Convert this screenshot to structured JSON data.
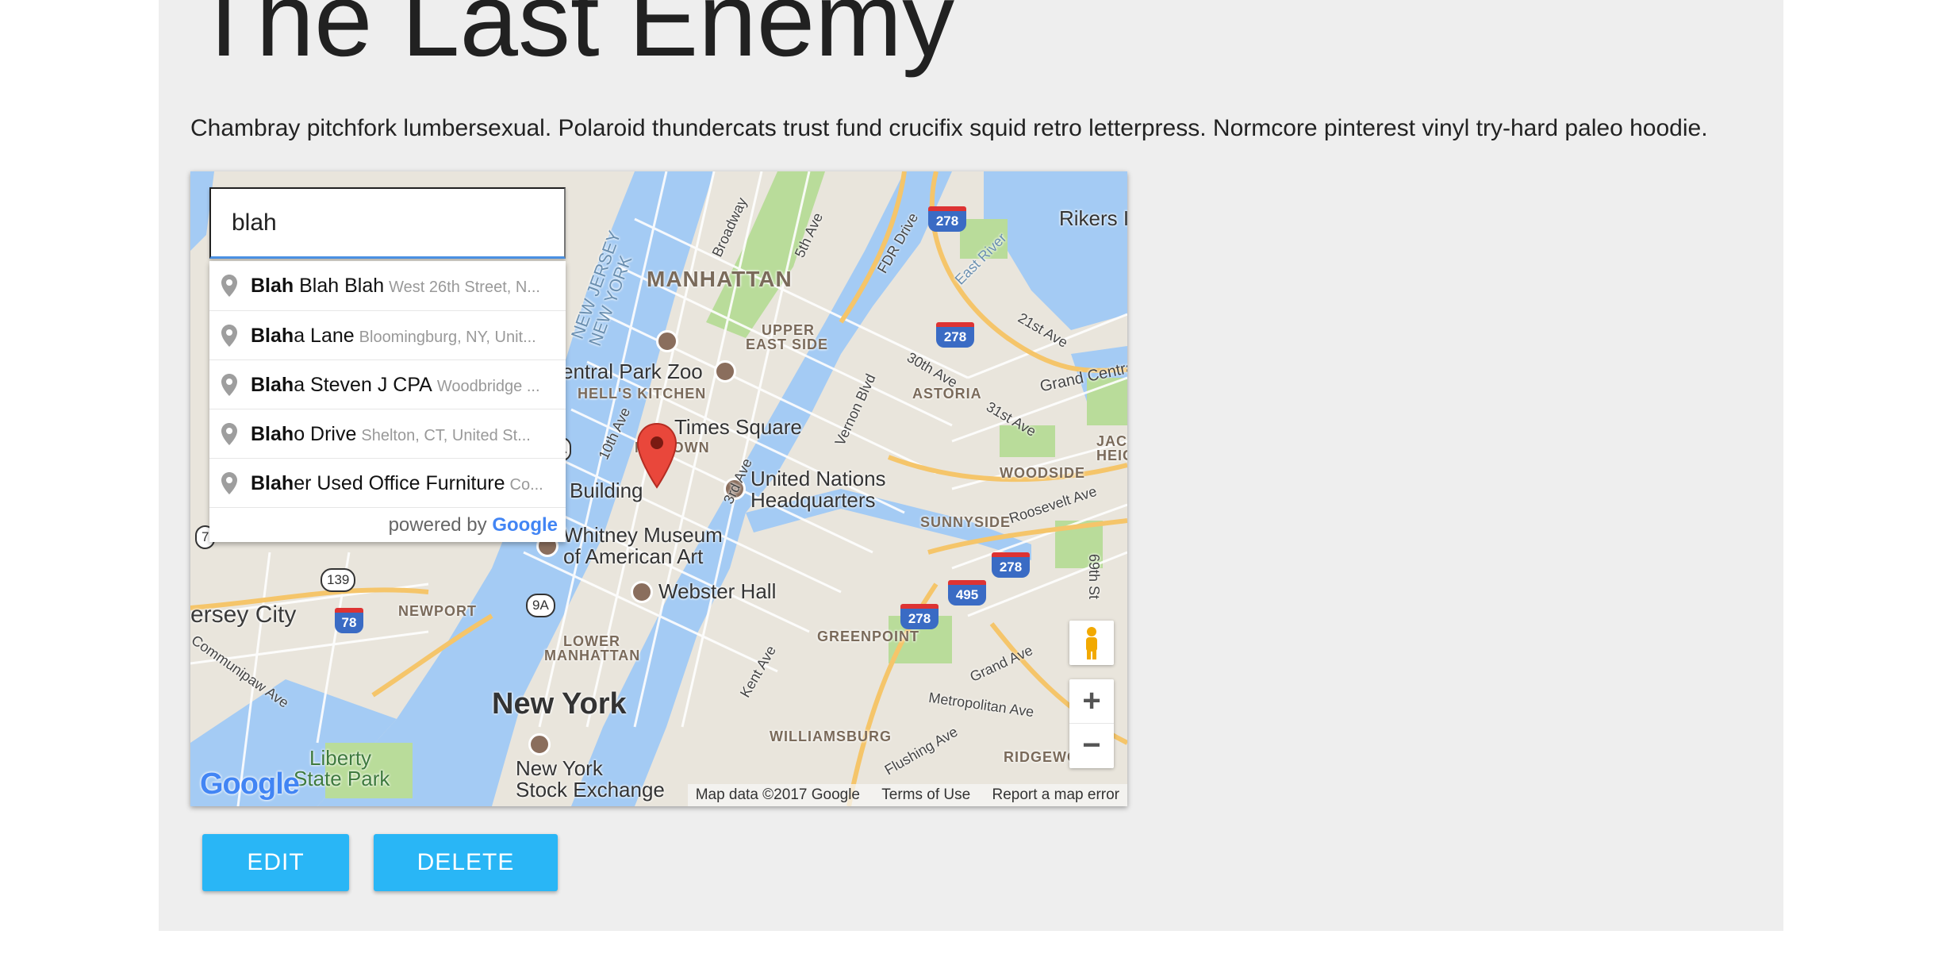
{
  "card": {
    "title": "The Last Enemy",
    "description": "Chambray pitchfork lumbersexual. Polaroid thundercats trust fund crucifix squid retro letterpress. Normcore pinterest vinyl try-hard paleo hoodie."
  },
  "search": {
    "value": "blah"
  },
  "autocomplete": {
    "items": [
      {
        "match": "Blah",
        "rest": " Blah Blah",
        "secondary": "West 26th Street, N..."
      },
      {
        "match": "Blah",
        "rest": "a Lane",
        "secondary": "Bloomingburg, NY, Unit..."
      },
      {
        "match": "Blah",
        "rest": "a Steven J CPA",
        "secondary": "Woodbridge ..."
      },
      {
        "match": "Blah",
        "rest": "o Drive",
        "secondary": "Shelton, CT, United St..."
      },
      {
        "match": "Blah",
        "rest": "er Used Office Furniture",
        "secondary": "Co..."
      }
    ],
    "footer_prefix": "powered by",
    "footer_brand": "Google"
  },
  "map": {
    "labels": {
      "manhattan": "MANHATTAN",
      "upper_east_side_1": "UPPER",
      "upper_east_side_2": "EAST SIDE",
      "hells_kitchen": "HELL'S KITCHEN",
      "central_park_zoo": "entral Park Zoo",
      "times_square": "Times Square",
      "building": "Building",
      "midtown": "MIDTOWN",
      "un_1": "United Nations",
      "un_2": "Headquarters",
      "whitney_1": "Whitney Museum",
      "whitney_2": "of American Art",
      "webster_hall": "Webster Hall",
      "jersey_city": "ersey City",
      "newport": "NEWPORT",
      "lower_manhattan_1": "LOWER",
      "lower_manhattan_2": "MANHATTAN",
      "new_york": "New York",
      "nyse_1": "New York",
      "nyse_2": "Stock Exchange",
      "liberty_1": "Liberty",
      "liberty_2": "State Park",
      "astoria": "ASTORIA",
      "woodside": "WOODSIDE",
      "sunnyside": "SUNNYSIDE",
      "greenpoint": "GREENPOINT",
      "williamsburg": "WILLIAMSBURG",
      "ridgewood": "RIDGEWO",
      "rikers": "Rikers I",
      "jackson_1": "JAC",
      "jackson_2": "HEIG",
      "grand_central": "Grand Centra",
      "roosevelt_ave": "Roosevelt Ave",
      "grand_ave": "Grand Ave",
      "metropolitan_ave": "Metropolitan Ave",
      "flushing_ave": "Flushing Ave",
      "kent_ave": "Kent Ave",
      "vernon_blvd": "Vernon Blvd",
      "fdr_drive": "FDR Drive",
      "east_river": "East River",
      "broadway": "Broadway",
      "fifth_ave": "5th Ave",
      "third_ave": "3rd Ave",
      "tenth_ave": "10th Ave",
      "thirtieth_ave": "30th Ave",
      "thirty_first_ave": "31st Ave",
      "twenty_first_ave": "21st Ave",
      "sixty_ninth_st": "69th St",
      "communipaw_ave": "Communipaw Ave",
      "new_jersey_1": "NEW JERSEY",
      "new_jersey_2": "NEW YORK"
    },
    "shields": {
      "i278_a": "278",
      "i278_b": "278",
      "i278_c": "278",
      "i278_d": "278",
      "i495": "495",
      "i78": "78"
    },
    "routes": {
      "r139": "139",
      "r9a": "9A",
      "r7": "7",
      "r9a_top": "A"
    },
    "logo": "Google",
    "attribution": {
      "data": "Map data ©2017 Google",
      "terms": "Terms of Use",
      "report": "Report a map error"
    },
    "zoom_in": "+",
    "zoom_out": "−"
  },
  "actions": {
    "edit": "Edit",
    "delete": "Delete"
  },
  "colors": {
    "button": "#29b6f6",
    "card_bg": "#eeeeee",
    "water": "#a4cbf4",
    "park": "#b9dc9a",
    "highway": "#f5c56a",
    "marker": "#e9473b"
  }
}
